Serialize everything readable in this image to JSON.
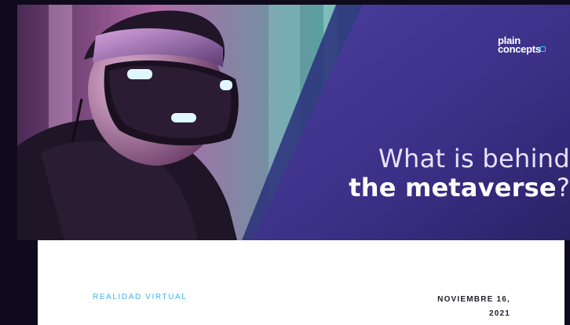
{
  "hero": {
    "logo_line1": "plain",
    "logo_line2": "concepts",
    "title_light": "What is behind",
    "title_bold": "the metaverse",
    "title_mark": "?"
  },
  "meta": {
    "category": "REALIDAD VIRTUAL",
    "date_line1": "NOVIEMBRE 16,",
    "date_line2": "2021"
  },
  "colors": {
    "accent": "#46b3e6",
    "hero_purple": "#3c2f8a",
    "text_dark": "#1f1f2a"
  }
}
